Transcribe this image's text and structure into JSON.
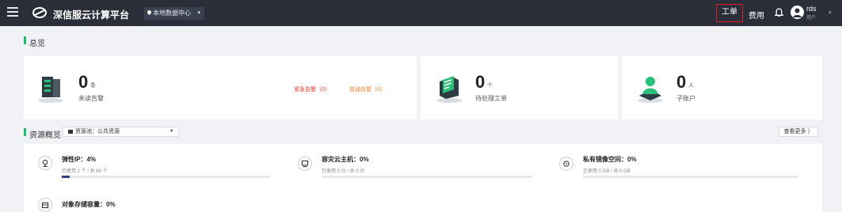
{
  "topbar": {
    "brand": "深信服云计算平台",
    "region": "本地数据中心",
    "nav_ticket": "工单",
    "nav_fee": "费用",
    "user_name": "rds",
    "user_role": "用户",
    "icons": [
      "menu-icon",
      "logo-icon",
      "location-pin-icon",
      "bell-icon",
      "avatar-icon",
      "chevron-down-icon"
    ]
  },
  "overview": {
    "title": "总览",
    "alerts": {
      "count": "0",
      "unit": "条",
      "label": "未读告警",
      "urgent_link": "紧急告警（0）",
      "normal_link": "普通告警（0）"
    },
    "tickets": {
      "count": "0",
      "unit": "个",
      "label": "待处理工单"
    },
    "subaccounts": {
      "count": "0",
      "unit": "人",
      "label": "子账户"
    }
  },
  "resources": {
    "title": "资源概览",
    "pool_select": "资源池：公共资源",
    "more_button": "查看更多 〉",
    "items": [
      {
        "title": "弹性IP：4%",
        "sub": "已使用 2 个 / 共 60 个",
        "percent": 4,
        "icon": "elastic-ip-icon"
      },
      {
        "title": "容灾云主机：0%",
        "sub": "已使用 0 台 / 共 0 台",
        "percent": 0,
        "icon": "dr-vm-icon"
      },
      {
        "title": "私有镜像空间：0%",
        "sub": "已使用 0 GB / 共 0 GB",
        "percent": 0,
        "icon": "image-space-icon"
      },
      {
        "title": "对象存储容量：0%",
        "sub": "",
        "percent": 0,
        "icon": "object-storage-icon"
      }
    ]
  },
  "colors": {
    "topbar": "#2a2e38",
    "accent_green": "#1ec06b",
    "urgent": "#e0403a",
    "normal": "#f0883a",
    "progress": "#2f3f86",
    "highlight_border": "#e02020"
  }
}
